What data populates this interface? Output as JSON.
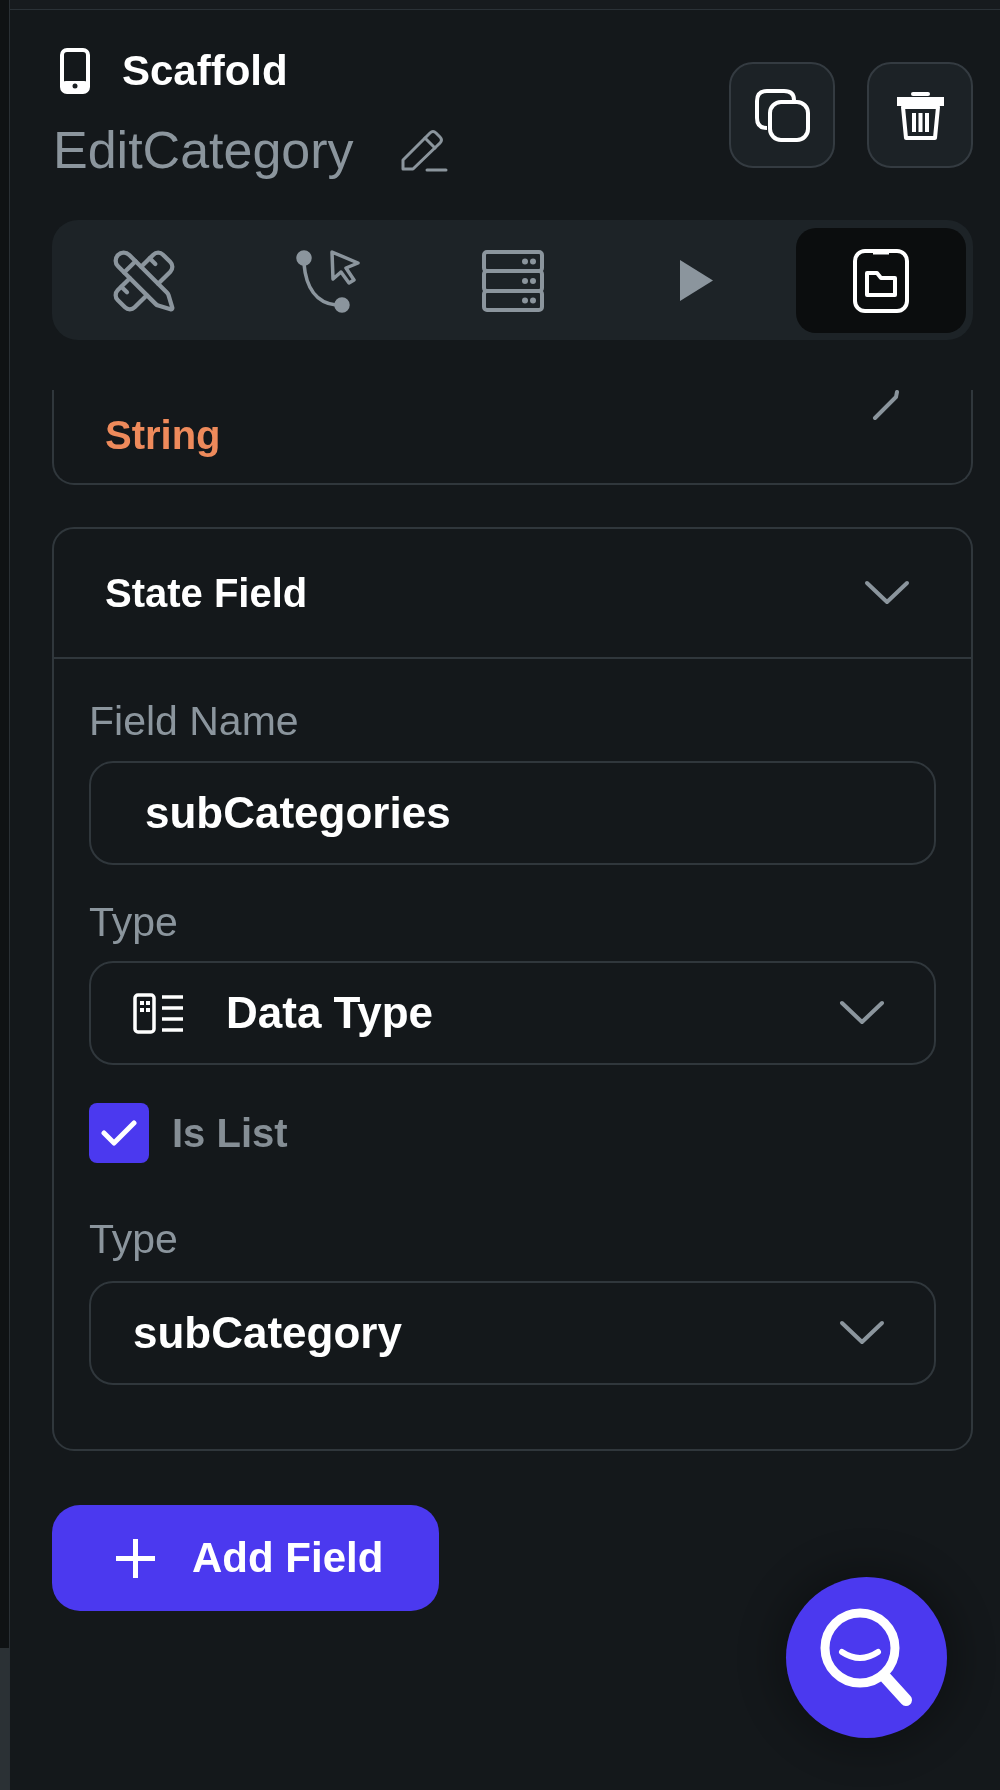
{
  "panel": {
    "type": "Scaffold",
    "name": "EditCategory"
  },
  "tabs": [
    {
      "selected": false
    },
    {
      "selected": false
    },
    {
      "selected": false
    },
    {
      "selected": false
    },
    {
      "selected": true
    }
  ],
  "previous_field": {
    "type": "String"
  },
  "state_field": {
    "title": "State Field",
    "expanded": true,
    "field_name": {
      "label": "Field Name",
      "value": "subCategories"
    },
    "type": {
      "label": "Type",
      "value": "Data Type"
    },
    "is_list": {
      "label": "Is List",
      "checked": true
    },
    "list_type": {
      "label": "Type",
      "value": "subCategory"
    }
  },
  "add_button": {
    "label": "Add Field"
  }
}
